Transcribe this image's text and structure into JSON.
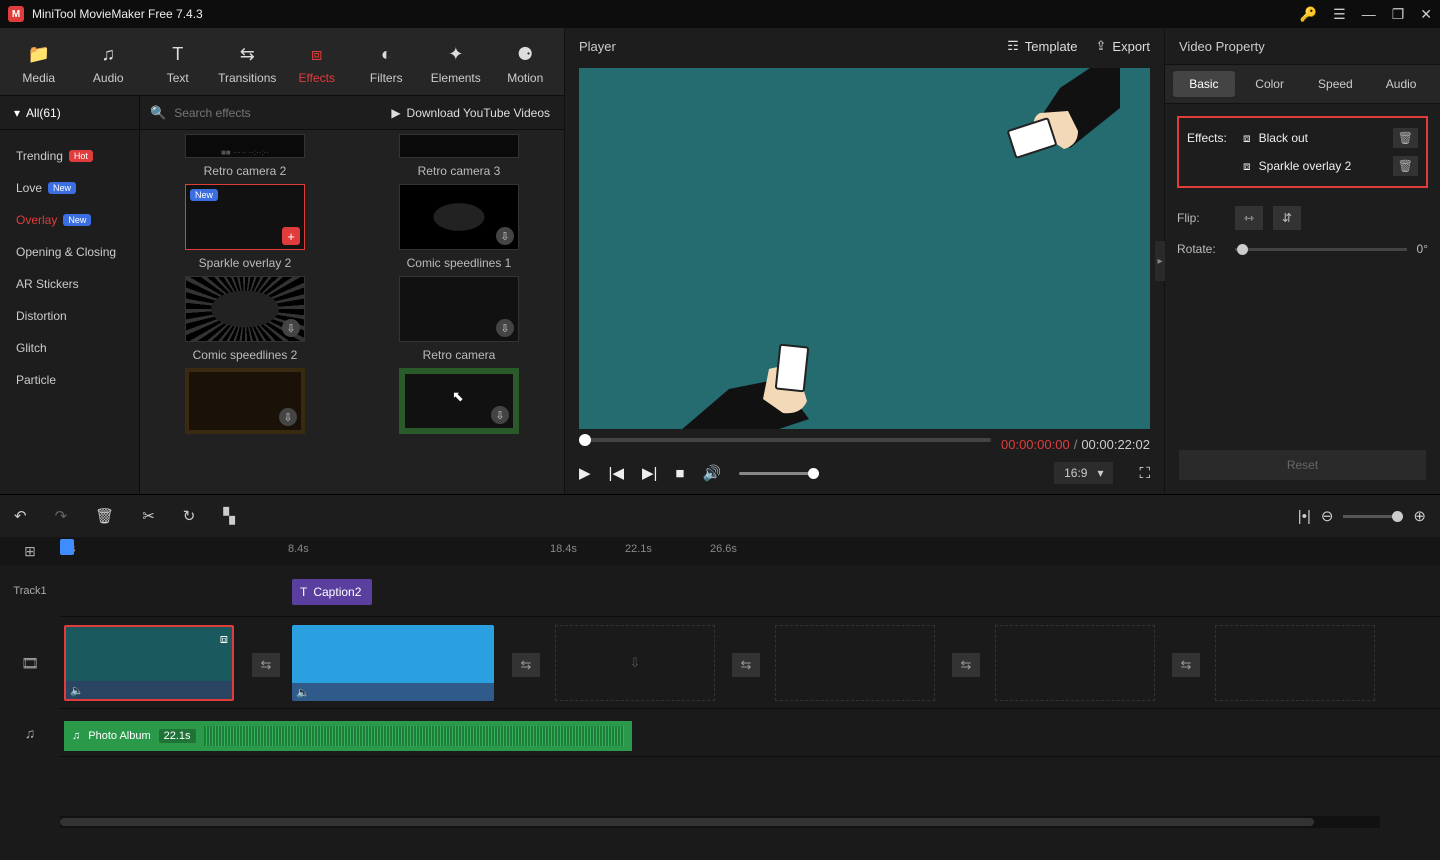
{
  "titlebar": {
    "title": "MiniTool MovieMaker Free 7.4.3"
  },
  "tabs": {
    "media": "Media",
    "audio": "Audio",
    "text": "Text",
    "transitions": "Transitions",
    "effects": "Effects",
    "filters": "Filters",
    "elements": "Elements",
    "motion": "Motion"
  },
  "subheader": {
    "all": "All(61)",
    "search_placeholder": "Search effects",
    "download": "Download YouTube Videos"
  },
  "categories": {
    "trending": "Trending",
    "love": "Love",
    "overlay": "Overlay",
    "opening": "Opening & Closing",
    "ar": "AR Stickers",
    "distortion": "Distortion",
    "glitch": "Glitch",
    "particle": "Particle",
    "hot": "Hot",
    "new": "New"
  },
  "thumbs": {
    "retro2": "Retro camera 2",
    "retro3": "Retro camera 3",
    "sparkle2": "Sparkle overlay 2",
    "comic1": "Comic speedlines 1",
    "comic2": "Comic speedlines 2",
    "retro": "Retro camera"
  },
  "player": {
    "title": "Player",
    "template": "Template",
    "export": "Export",
    "cur": "00:00:00:00",
    "total": "00:00:22:02",
    "aspect": "16:9"
  },
  "props": {
    "title": "Video Property",
    "tabs": {
      "basic": "Basic",
      "color": "Color",
      "speed": "Speed",
      "audio": "Audio"
    },
    "effects_label": "Effects:",
    "eff1": "Black out",
    "eff2": "Sparkle overlay 2",
    "flip": "Flip:",
    "rotate": "Rotate:",
    "rotate_val": "0°",
    "reset": "Reset"
  },
  "timeline": {
    "ticks": {
      "t0": "0s",
      "t1": "8.4s",
      "t2": "18.4s",
      "t3": "22.1s",
      "t4": "26.6s"
    },
    "track1": "Track1",
    "caption": "Caption2",
    "audio_name": "Photo Album",
    "audio_dur": "22.1s"
  }
}
